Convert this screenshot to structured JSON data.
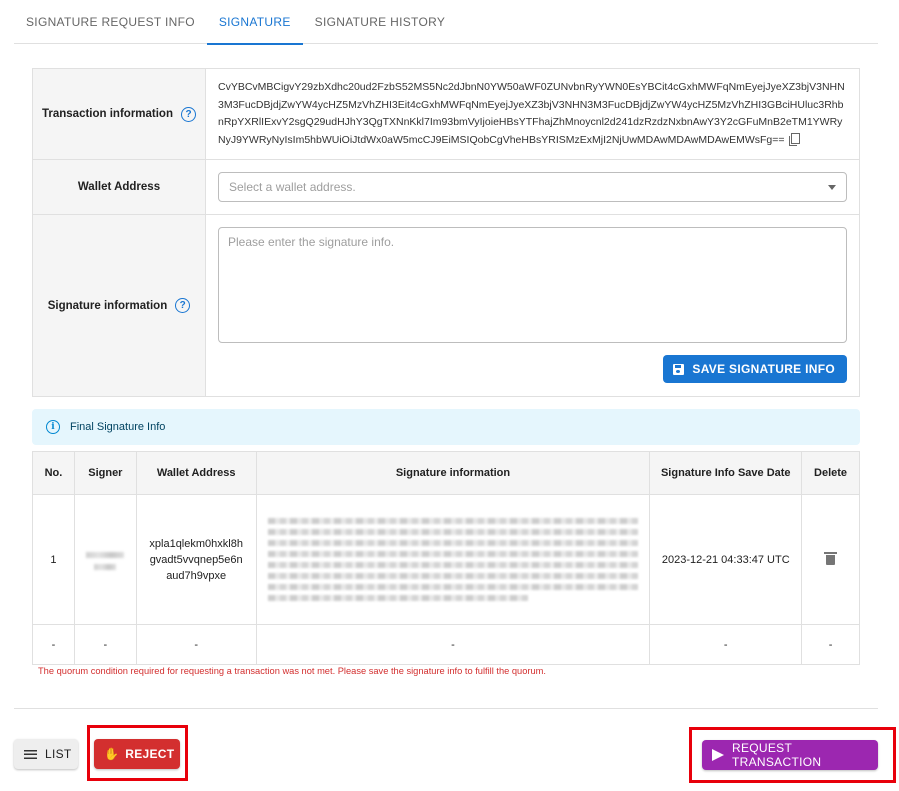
{
  "tabs": [
    {
      "label": "SIGNATURE REQUEST INFO"
    },
    {
      "label": "SIGNATURE",
      "active": true
    },
    {
      "label": "SIGNATURE HISTORY"
    }
  ],
  "form": {
    "transaction_label": "Transaction information",
    "transaction_value": "CvYBCvMBCigvY29zbXdhc20ud2FzbS52MS5Nc2dJbnN0YW50aWF0ZUNvbnRyYWN0EsYBCit4cGxhMWFqNmEyejJyeXZ3bjV3NHN3M3FucDBjdjZwYW4ycHZ5MzVhZHI3Eit4cGxhMWFqNmEyejJyeXZ3bjV3NHN3M3FucDBjdjZwYW4ycHZ5MzVhZHI3GBciHUluc3RhbnRpYXRlIExvY2sgQ29udHJhY3QgTXNnKkl7Im93bmVyIjoieHBsYTFhajZhMnoycnl2d241dzRzdzNxbnAwY3Y2cGFuMnB2eTM1YWRyNyJ9YWRyNyIsIm5hbWUiOiJtdWx0aW5mcCJ9EiMSIQobCgVheHBsYRISMzExMjI2NjUwMDAwMDAwMDAwEMWsFg==",
    "wallet_label": "Wallet Address",
    "wallet_placeholder": "Select a wallet address.",
    "signature_label": "Signature information",
    "signature_placeholder": "Please enter the signature info.",
    "save_label": "SAVE SIGNATURE INFO"
  },
  "alert": {
    "text": "Final Signature Info",
    "color": "#e5f6fd"
  },
  "signature_table": {
    "headers": [
      "No.",
      "Signer",
      "Wallet Address",
      "Signature information",
      "Signature Info Save Date",
      "Delete"
    ],
    "rows": [
      {
        "no": "1",
        "wallet": "xpla1qlekm0hxkl8hgvadt5vvqnep5e6naud7h9vpxe",
        "date": "2023-12-21 04:33:47 UTC"
      }
    ],
    "empty_row": [
      "-",
      "-",
      "-",
      "-",
      "-",
      "-"
    ]
  },
  "warning": "The quorum condition required for requesting a transaction was not met. Please save the signature info to fulfill the quorum.",
  "buttons": {
    "list_label": "LIST",
    "reject_label": "REJECT",
    "request_label": "REQUEST TRANSACTION"
  },
  "colors": {
    "primary": "#1976d2",
    "reject": "#d32f2f",
    "request": "#9c27b0",
    "highlight": "#e8000b"
  },
  "icons": [
    "help-icon",
    "copy-icon",
    "chevron-down-icon",
    "floppy-disk-icon",
    "info-icon",
    "trash-icon",
    "list-icon",
    "hand-icon",
    "send-icon"
  ]
}
